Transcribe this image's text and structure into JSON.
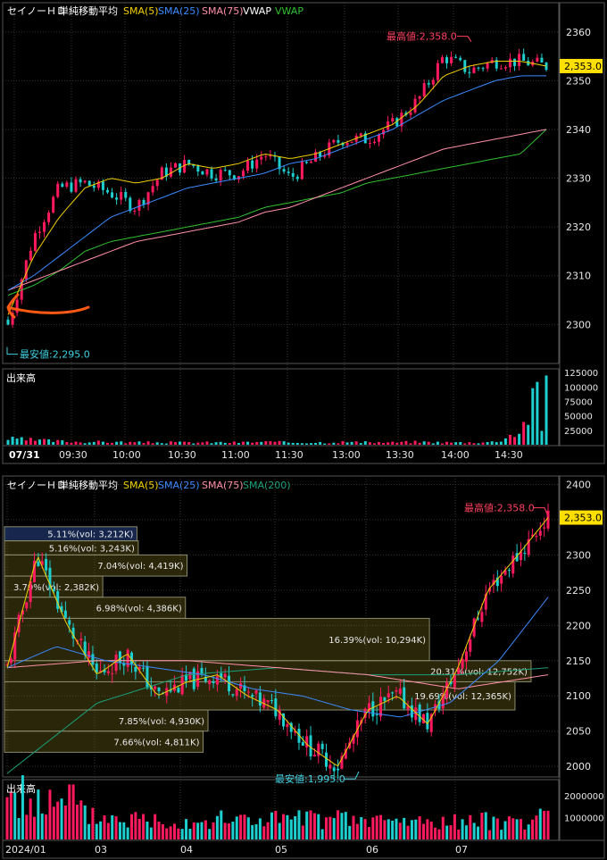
{
  "colors": {
    "up": "#ff1a5e",
    "down": "#1ecfcf",
    "sma5": "#f0d000",
    "sma25": "#3a8bff",
    "sma75": "#ff8fa8",
    "vwap_white": "#ffffff",
    "vwap_green": "#30c030",
    "sma200": "#1aa07a",
    "grid": "#333333",
    "axis_text": "#e6e6e6",
    "high_label": "#ff4060",
    "low_label": "#40d0e0",
    "annot_arrow": "#ff5a14"
  },
  "intraday": {
    "legend": {
      "name": "セイノーＨＤ",
      "type": "単純移動平均",
      "sma5": "SMA(5)",
      "sma25": "SMA(25)",
      "sma75": "SMA(75)",
      "vwap1": "VWAP",
      "vwap2": "VWAP"
    },
    "price_ticks": [
      "2360",
      "2350",
      "2340",
      "2330",
      "2320",
      "2310",
      "2300"
    ],
    "price_tick_values": [
      2360,
      2350,
      2340,
      2330,
      2320,
      2310,
      2300
    ],
    "current_price": "2,353.0",
    "high_label": "最高値:2,358.0",
    "low_label": "最安値:2,295.0",
    "volume_title": "出来高",
    "volume_ticks": [
      "125000",
      "100000",
      "75000",
      "50000",
      "25000"
    ],
    "volume_tick_values": [
      125000,
      100000,
      75000,
      50000,
      25000
    ],
    "time_labels": [
      "07/31",
      "09:30",
      "10:00",
      "10:30",
      "11:00",
      "11:30",
      "13:00",
      "13:30",
      "14:00",
      "14:30"
    ]
  },
  "daily": {
    "legend": {
      "name": "セイノーＨＤ",
      "type": "単純移動平均",
      "sma5": "SMA(5)",
      "sma25": "SMA(25)",
      "sma75": "SMA(75)",
      "sma200": "SMA(200)"
    },
    "price_ticks": [
      "2400",
      "2350",
      "2300",
      "2250",
      "2200",
      "2150",
      "2100",
      "2050",
      "2000"
    ],
    "price_tick_values": [
      2400,
      2350,
      2300,
      2250,
      2200,
      2150,
      2100,
      2050,
      2000
    ],
    "current_price": "2,353.0",
    "high_label": "最高値:2,358.0",
    "low_label": "最安値:1,995.0",
    "volume_title": "出来高",
    "volume_ticks": [
      "2000000",
      "1000000"
    ],
    "volume_tick_values": [
      2000000,
      1000000
    ],
    "date_labels": [
      "2024/01",
      "03",
      "04",
      "05",
      "06",
      "07"
    ],
    "volume_profile": [
      {
        "label": "5.11%(vol: 3,212K)",
        "pct": 5.11,
        "price_hi": 2340,
        "price_lo": 2320
      },
      {
        "label": "5.16%(vol: 3,243K)",
        "pct": 5.16,
        "price_hi": 2320,
        "price_lo": 2300
      },
      {
        "label": "7.04%(vol: 4,419K)",
        "pct": 7.04,
        "price_hi": 2300,
        "price_lo": 2270
      },
      {
        "label": "3.79%(vol: 2,382K)",
        "pct": 3.79,
        "price_hi": 2270,
        "price_lo": 2240
      },
      {
        "label": "6.98%(vol: 4,386K)",
        "pct": 6.98,
        "price_hi": 2240,
        "price_lo": 2210
      },
      {
        "label": "16.39%(vol: 10,294K)",
        "pct": 16.39,
        "price_hi": 2210,
        "price_lo": 2150
      },
      {
        "label": "20.31%(vol: 12,752K)",
        "pct": 20.31,
        "price_hi": 2150,
        "price_lo": 2120
      },
      {
        "label": "19.69%(vol: 12,365K)",
        "pct": 19.69,
        "price_hi": 2120,
        "price_lo": 2080
      },
      {
        "label": "7.85%(vol: 4,930K)",
        "pct": 7.85,
        "price_hi": 2080,
        "price_lo": 2050
      },
      {
        "label": "7.66%(vol: 4,811K)",
        "pct": 7.66,
        "price_hi": 2050,
        "price_lo": 2020
      }
    ]
  },
  "chart_data": [
    {
      "type": "candlestick",
      "ylim": [
        2292,
        2366
      ],
      "volume_ylim": [
        0,
        130000
      ],
      "x": [
        "09:00",
        "09:15",
        "09:30",
        "09:45",
        "10:00",
        "10:15",
        "10:30",
        "10:45",
        "11:00",
        "11:15",
        "11:30",
        "12:30",
        "12:45",
        "13:00",
        "13:15",
        "13:30",
        "13:45",
        "14:00",
        "14:15",
        "14:30",
        "14:45",
        "15:00"
      ],
      "close": [
        2300,
        2318,
        2328,
        2329,
        2327,
        2324,
        2331,
        2333,
        2331,
        2331,
        2335,
        2330,
        2334,
        2338,
        2338,
        2341,
        2346,
        2355,
        2352,
        2354,
        2354,
        2353
      ],
      "sma5": [
        2302,
        2314,
        2322,
        2328,
        2330,
        2329,
        2330,
        2333,
        2332,
        2333,
        2335,
        2334,
        2335,
        2337,
        2339,
        2341,
        2345,
        2351,
        2353,
        2354,
        2354,
        2353
      ],
      "sma25": [
        2307,
        2310,
        2314,
        2318,
        2322,
        2324,
        2326,
        2328,
        2329,
        2330,
        2331,
        2333,
        2334,
        2336,
        2338,
        2340,
        2343,
        2346,
        2348,
        2350,
        2351,
        2351
      ],
      "sma75": [
        2307,
        2309,
        2311,
        2313,
        2315,
        2317,
        2318,
        2319,
        2320,
        2321,
        2323,
        2324,
        2326,
        2328,
        2330,
        2332,
        2334,
        2336,
        2337,
        2338,
        2339,
        2340
      ],
      "vwap": [
        2306,
        2308,
        2311,
        2315,
        2317,
        2318,
        2319,
        2320,
        2321,
        2322,
        2324,
        2325,
        2326,
        2327,
        2329,
        2330,
        2331,
        2332,
        2333,
        2334,
        2335,
        2340
      ],
      "volume": [
        10000,
        8000,
        6000,
        5000,
        5000,
        4000,
        4000,
        4000,
        4000,
        4000,
        5000,
        4000,
        4000,
        5000,
        4000,
        4000,
        5000,
        4000,
        4000,
        5000,
        25000,
        120000
      ]
    },
    {
      "type": "candlestick",
      "ylim": [
        1985,
        2412
      ],
      "volume_ylim": [
        0,
        2600000
      ],
      "x": [
        "2024-01",
        "2024-02",
        "2024-03",
        "2024-04",
        "2024-05",
        "2024-06",
        "2024-07"
      ],
      "close": [
        2140,
        2200,
        2140,
        2120,
        2100,
        2080,
        2353
      ],
      "sma5": [
        2140,
        2220,
        2140,
        2110,
        2110,
        2060,
        2330
      ],
      "sma25": [
        2150,
        2180,
        2160,
        2140,
        2120,
        2070,
        2240
      ],
      "sma75": [
        2140,
        2150,
        2150,
        2140,
        2130,
        2110,
        2130
      ],
      "sma200": [
        1990,
        2090,
        2130,
        2140,
        2130,
        2130,
        2140
      ],
      "volume": [
        2500000,
        1200000,
        1000000,
        1100000,
        1000000,
        900000,
        1100000
      ]
    }
  ]
}
